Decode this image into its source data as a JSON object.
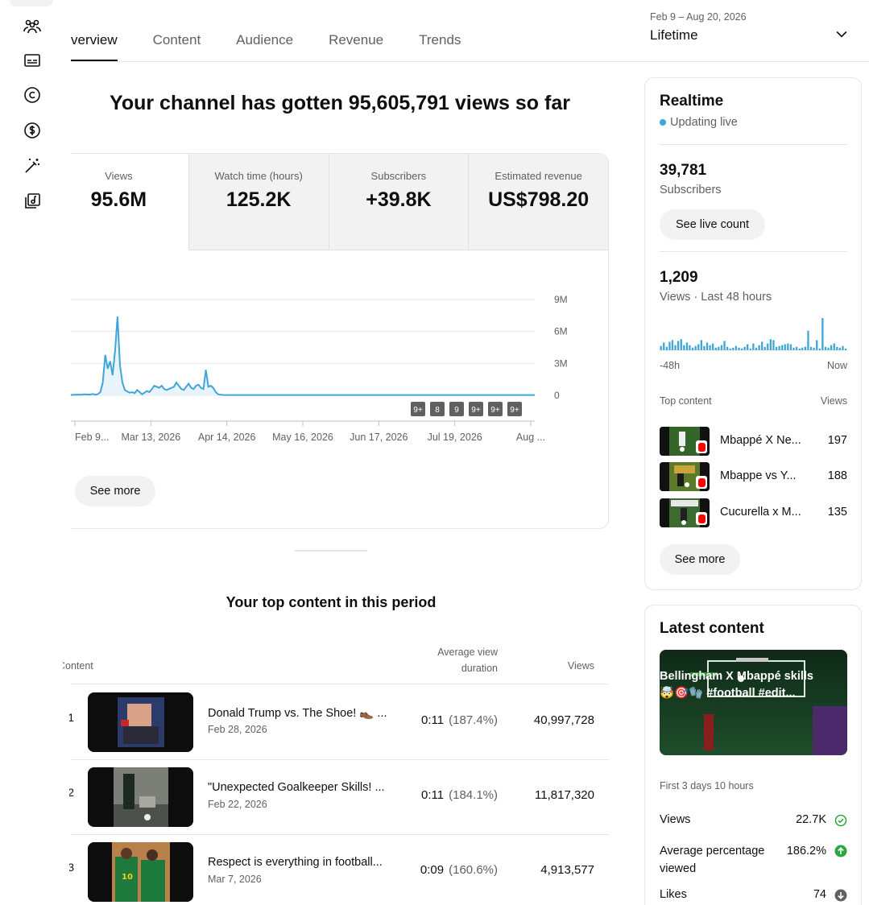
{
  "tabs": [
    {
      "label": "verview"
    },
    {
      "label": "Content"
    },
    {
      "label": "Audience"
    },
    {
      "label": "Revenue"
    },
    {
      "label": "Trends"
    }
  ],
  "date_picker": {
    "range": "Feb 9 – Aug 20, 2026",
    "period": "Lifetime"
  },
  "headline": "Your channel has gotten 95,605,791 views so far",
  "metrics": [
    {
      "label": "Views",
      "value": "95.6M"
    },
    {
      "label": "Watch time (hours)",
      "value": "125.2K"
    },
    {
      "label": "Subscribers",
      "value": "+39.8K"
    },
    {
      "label": "Estimated revenue",
      "value": "US$798.20"
    }
  ],
  "chart_data": {
    "type": "area",
    "title": "",
    "x_tick_labels": [
      "Feb 9...",
      "Mar 13, 2026",
      "Apr 14, 2026",
      "May 16, 2026",
      "Jun 17, 2026",
      "Jul 19, 2026",
      "Aug ..."
    ],
    "y_tick_labels": [
      "9M",
      "6M",
      "3M",
      "0"
    ],
    "ylim": [
      0,
      9000000
    ],
    "x_range": [
      "2026-02-09",
      "2026-08-20"
    ],
    "series": [
      {
        "values": [
          30000,
          60000,
          50000,
          70000,
          60000,
          80000,
          100000,
          70000,
          80000,
          120000,
          60000,
          110000,
          300000,
          1200000,
          3800000,
          2500000,
          3200000,
          1900000,
          4200000,
          7400000,
          2800000,
          1200000,
          500000,
          350000,
          250000,
          300000,
          200000,
          500000,
          300000,
          100000,
          250000,
          400000,
          300000,
          600000,
          900000,
          800000,
          700000,
          900000,
          600000,
          500000,
          600000,
          700000,
          800000,
          1200000,
          900000,
          600000,
          500000,
          800000,
          1100000,
          700000,
          600000,
          900000,
          1000000,
          700000,
          600000,
          2400000,
          800000,
          900000,
          700000,
          300000,
          100000,
          50000,
          40000,
          30000,
          30000,
          30000,
          30000,
          30000,
          30000,
          30000,
          30000,
          30000,
          30000,
          30000,
          30000,
          30000,
          30000,
          30000,
          30000,
          30000,
          30000,
          30000,
          30000,
          30000,
          30000,
          30000,
          30000,
          30000,
          30000,
          30000,
          30000,
          30000,
          30000,
          30000,
          30000,
          30000,
          30000,
          30000,
          30000,
          30000,
          30000,
          30000,
          30000,
          30000,
          30000,
          30000,
          30000,
          30000,
          30000,
          30000,
          30000,
          30000,
          30000,
          30000,
          30000,
          30000,
          30000,
          30000,
          30000,
          30000,
          30000,
          30000,
          30000,
          30000,
          30000,
          30000,
          30000,
          30000,
          30000,
          30000,
          30000,
          30000,
          30000,
          30000,
          30000,
          30000,
          30000,
          30000,
          30000,
          30000,
          30000,
          30000,
          30000,
          30000,
          30000,
          30000,
          30000,
          30000,
          30000,
          30000,
          30000,
          30000,
          30000,
          30000,
          30000,
          30000,
          30000,
          30000,
          30000,
          30000,
          30000,
          30000,
          30000,
          30000,
          30000,
          30000,
          30000,
          30000,
          30000,
          30000,
          30000,
          30000,
          30000,
          30000,
          30000,
          30000,
          30000,
          30000,
          30000,
          30000,
          30000,
          30000,
          30000,
          30000,
          30000,
          30000,
          30000,
          30000,
          30000,
          30000
        ]
      }
    ],
    "markers": [
      "9+",
      "8",
      "9",
      "9+",
      "9+",
      "9+"
    ]
  },
  "see_more_main": "See more",
  "top_content": {
    "title": "Your top content in this period",
    "headers": {
      "content": "Content",
      "avd_line1": "Average view",
      "avd_line2": "duration",
      "views": "Views"
    },
    "rows": [
      {
        "rank": "1",
        "title": "Donald Trump vs. The Shoe! 👞 ...",
        "date": "Feb 28, 2026",
        "avd": "0:11",
        "avd_pct": "(187.4%)",
        "views": "40,997,728"
      },
      {
        "rank": "2",
        "title": "\"Unexpected Goalkeeper Skills! ...",
        "date": "Feb 22, 2026",
        "avd": "0:11",
        "avd_pct": "(184.1%)",
        "views": "11,817,320"
      },
      {
        "rank": "3",
        "title": "Respect is everything in football...",
        "date": "Mar 7, 2026",
        "avd": "0:09",
        "avd_pct": "(160.6%)",
        "views": "4,913,577"
      }
    ]
  },
  "realtime": {
    "title": "Realtime",
    "live": "Updating live",
    "subscribers_value": "39,781",
    "subscribers_label": "Subscribers",
    "see_live_count": "See live count",
    "views_value": "1,209",
    "views_label": "Views · Last 48 hours",
    "axis_left": "-48h",
    "axis_right": "Now",
    "bars": [
      5,
      9,
      4,
      10,
      12,
      6,
      11,
      13,
      6,
      9,
      6,
      3,
      5,
      7,
      12,
      5,
      9,
      6,
      8,
      3,
      4,
      6,
      11,
      4,
      2,
      3,
      5,
      3,
      2,
      4,
      7,
      2,
      8,
      3,
      6,
      10,
      4,
      8,
      13,
      12,
      4,
      5,
      6,
      7,
      8,
      7,
      3,
      4,
      2,
      3,
      4,
      23,
      4,
      3,
      12,
      2,
      38,
      4,
      3,
      6,
      8,
      4,
      3,
      5,
      2
    ],
    "top_content_label": "Top content",
    "top_views_label": "Views",
    "top_items": [
      {
        "name": "Mbappé X Ne...",
        "views": "197"
      },
      {
        "name": "Mbappe vs Y...",
        "views": "188"
      },
      {
        "name": "Cucurella x M...",
        "views": "135"
      }
    ],
    "see_more": "See more"
  },
  "latest": {
    "title": "Latest content",
    "caption": "Bellingham X Mbappé skills 🤯🎯🧤 #football #edit...",
    "period": "First 3 days 10 hours",
    "stats": [
      {
        "label": "Views",
        "value": "22.7K",
        "status": "check",
        "color": "#2ba640"
      },
      {
        "label": "Average percentage viewed",
        "value": "186.2%",
        "status": "up",
        "color": "#2ba640"
      },
      {
        "label": "Likes",
        "value": "74",
        "status": "down",
        "color": "#606060"
      }
    ]
  },
  "colors": {
    "accent": "#3ea6d8",
    "chart_fill": "#e8f4fa"
  }
}
